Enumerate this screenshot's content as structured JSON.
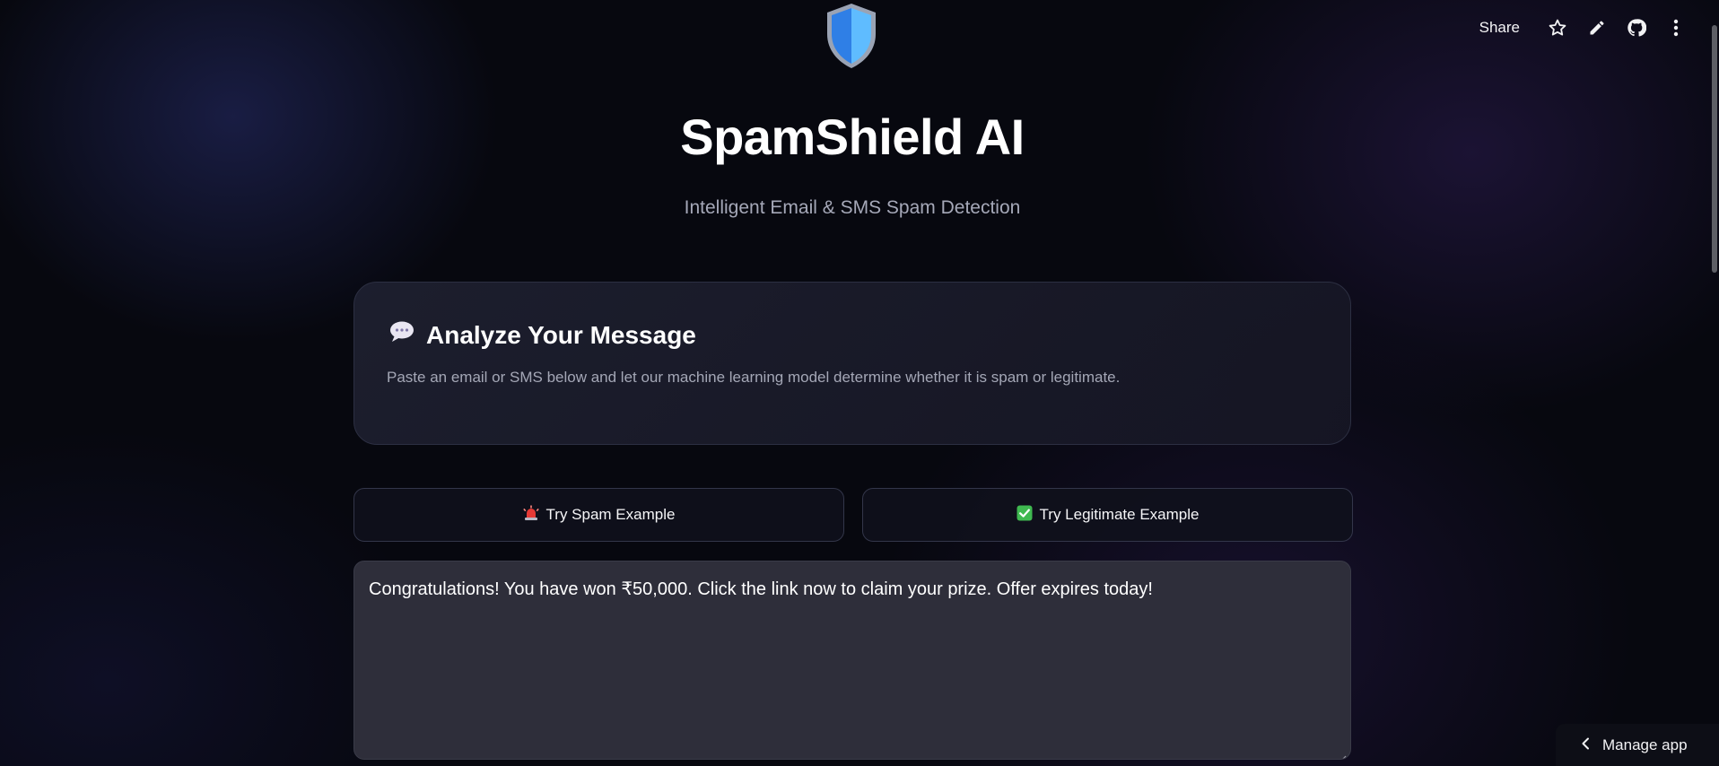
{
  "toolbar": {
    "share_label": "Share",
    "icons": [
      "star-icon",
      "pencil-icon",
      "github-icon",
      "more-vertical-icon"
    ]
  },
  "hero": {
    "logo_icon": "shield-icon",
    "title": "SpamShield AI",
    "subtitle": "Intelligent Email & SMS Spam Detection"
  },
  "card": {
    "heading_icon": "speech-bubble-icon",
    "heading": "Analyze Your Message",
    "description": "Paste an email or SMS below and let our machine learning model determine whether it is spam or legitimate."
  },
  "examples": {
    "spam_icon": "siren-icon",
    "spam_label": "Try Spam Example",
    "legit_icon": "check-mark-icon",
    "legit_label": "Try Legitimate Example"
  },
  "message": {
    "value": "Congratulations! You have won ₹50,000. Click the link now to claim your prize. Offer expires today!"
  },
  "manage_app": {
    "icon": "chevron-left-icon",
    "label": "Manage app"
  },
  "colors": {
    "background": "#07080f",
    "card_bg": "#1c1d2c",
    "textarea_bg": "#2e2e3a",
    "shield_light": "#5fbcff",
    "shield_dark": "#2f7fe6",
    "muted_text": "#a5a8b8"
  }
}
